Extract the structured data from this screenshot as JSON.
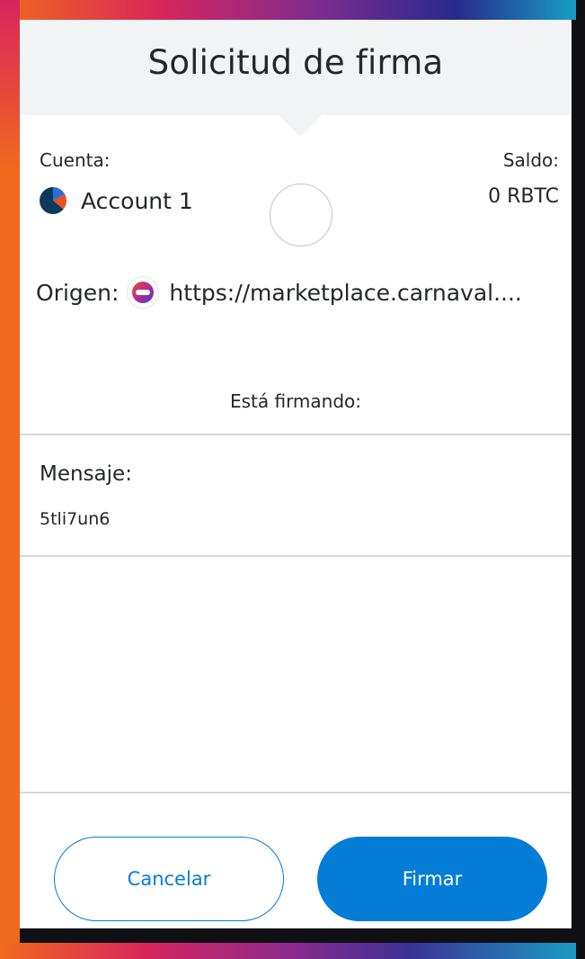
{
  "header": {
    "title": "Solicitud de firma"
  },
  "account": {
    "label": "Cuenta:",
    "name": "Account 1"
  },
  "balance": {
    "label": "Saldo:",
    "value": "0 RBTC"
  },
  "origin": {
    "label": "Origen:",
    "url": "https://marketplace.carnaval...."
  },
  "signing": {
    "label": "Está firmando:"
  },
  "message": {
    "title": "Mensaje:",
    "value": "5tli7un6"
  },
  "actions": {
    "cancel_label": "Cancelar",
    "sign_label": "Firmar"
  },
  "colors": {
    "accent": "#037dd6",
    "header_bg": "#f2f3f4",
    "text": "#24272a"
  }
}
